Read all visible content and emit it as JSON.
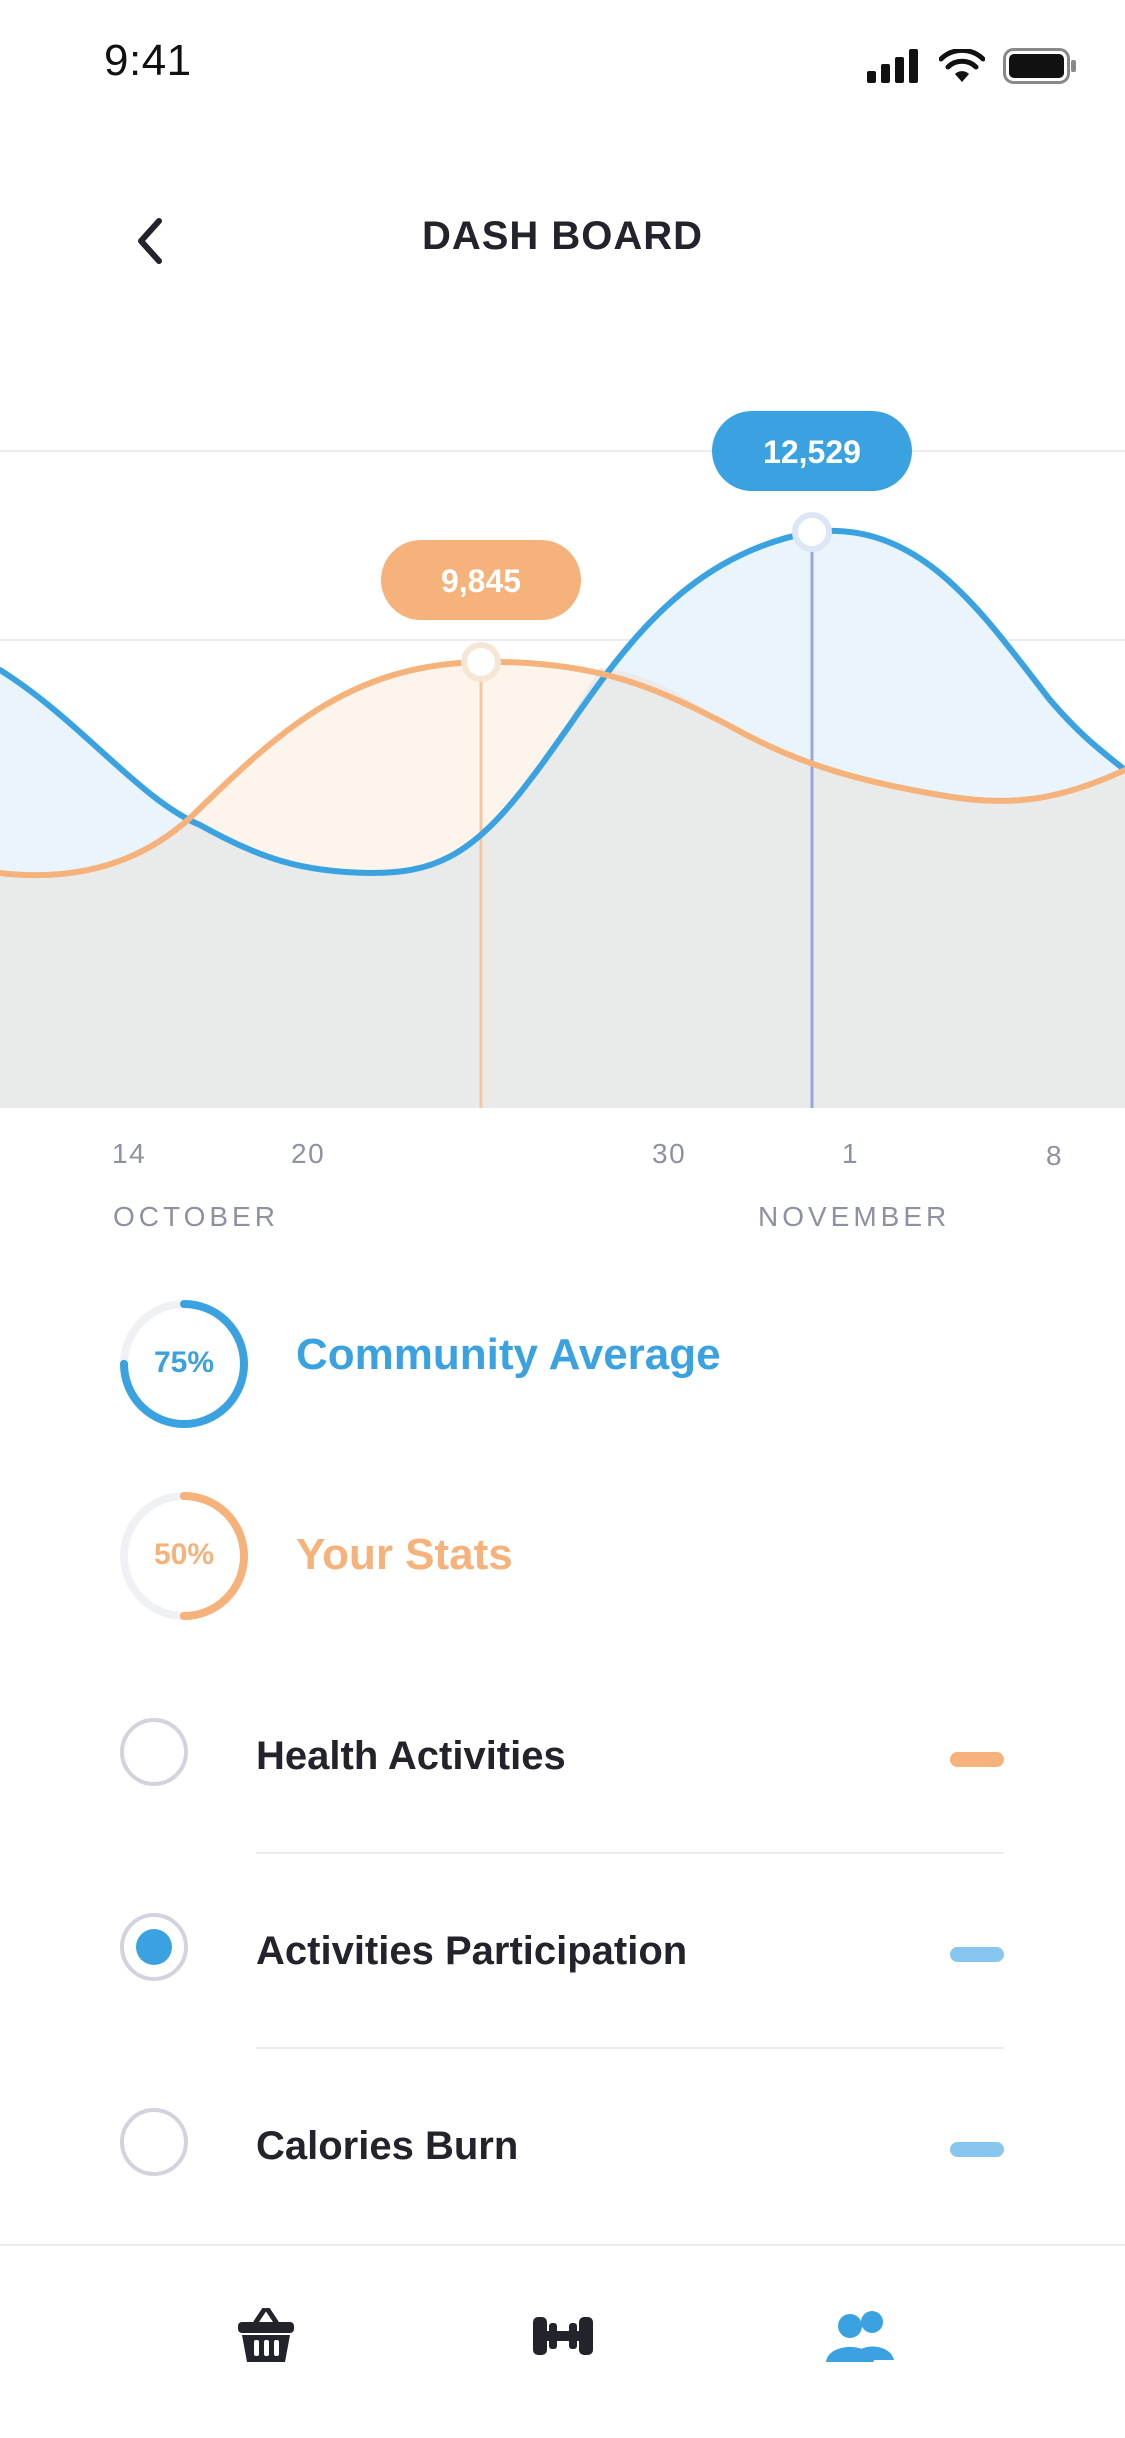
{
  "status_bar": {
    "time": "9:41"
  },
  "header": {
    "title": "DASH BOARD"
  },
  "chart_data": {
    "type": "area",
    "callouts": [
      {
        "series": "orange",
        "value_label": "9,845",
        "color": "#f5b27a"
      },
      {
        "series": "blue",
        "value_label": "12,529",
        "color": "#3aa2e0"
      }
    ],
    "x_ticks": [
      "14",
      "20",
      "30",
      "1",
      "8"
    ],
    "months": [
      "OCTOBER",
      "NOVEMBER"
    ],
    "series": [
      {
        "color": "#3aa2e0"
      },
      {
        "color": "#f5b27a"
      }
    ]
  },
  "stats": {
    "community": {
      "percent_label": "75%",
      "value": 0.75,
      "label": "Community Average",
      "color": "#3aa2e0"
    },
    "yours": {
      "percent_label": "50%",
      "value": 0.5,
      "label": "Your Stats",
      "color": "#f5b27a"
    }
  },
  "list": {
    "items": [
      {
        "label": "Health Activities",
        "selected": false,
        "color": "#f5b27a"
      },
      {
        "label": "Activities Participation",
        "selected": true,
        "color": "#86c6ef"
      },
      {
        "label": "Calories Burn",
        "selected": false,
        "color": "#86c6ef"
      }
    ]
  },
  "tabbar": {
    "tabs": [
      {
        "icon": "basket-icon",
        "active": false
      },
      {
        "icon": "dumbbell-icon",
        "active": false
      },
      {
        "icon": "people-icon",
        "active": true
      }
    ]
  }
}
